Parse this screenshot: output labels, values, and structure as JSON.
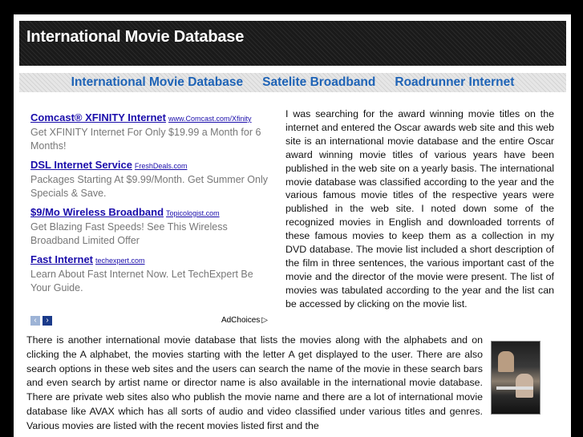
{
  "header": {
    "title": "International Movie Database"
  },
  "nav": {
    "links": [
      {
        "label": "International Movie Database"
      },
      {
        "label": "Satelite Broadband"
      },
      {
        "label": "Roadrunner Internet"
      }
    ]
  },
  "ads": {
    "items": [
      {
        "title": "Comcast® XFINITY Internet",
        "url": "www.Comcast.com/Xfinity",
        "desc": "Get XFINITY Internet For Only $19.99 a Month for 6 Months!"
      },
      {
        "title": "DSL Internet Service",
        "url": "FreshDeals.com",
        "desc": "Packages Starting At $9.99/Month. Get Summer Only Specials & Save."
      },
      {
        "title": "$9/Mo Wireless Broadband",
        "url": "Topicologist.com",
        "desc": "Get Blazing Fast Speeds! See This Wireless Broadband Limited Offer"
      },
      {
        "title": "Fast Internet",
        "url": "techexpert.com",
        "desc": "Learn About Fast Internet Now. Let TechExpert Be Your Guide."
      }
    ],
    "adchoices_label": "AdChoices"
  },
  "article": {
    "para1": "I was searching for the award winning movie titles on the internet and entered the Oscar awards web site and this web site is an international movie database and the entire Oscar award winning movie titles of various years have been published in the web site on a yearly basis. The international movie database was classified according to the year and the various famous movie titles of the respective years were published in the web site. I noted down some of the recognized movies in English and downloaded torrents of these famous movies to keep them as a collection in my DVD database. The movie list included a short description of the film in three sentences, the various important cast of the movie and the director of the movie were present. The list of movies was tabulated according to the year and the list can be accessed by clicking on the movie list.",
    "para2": "There is another international movie database that lists the movies along with the alphabets and on clicking the A alphabet, the movies starting with the letter A get displayed to the user. There are also search options in these web sites and the users can search the name of the movie in these search bars and even search by artist name or director name is also available in the international movie database. There are private web sites also who publish the movie name and there are a lot of international movie database like AVAX which has all sorts of audio and video classified under various titles and genres. Various movies are listed with the recent movies listed first and the"
  }
}
